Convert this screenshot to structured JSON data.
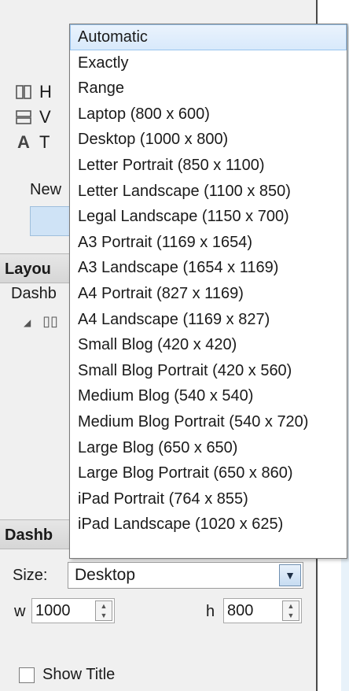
{
  "objects_panel": {
    "items": [
      {
        "icon": "horizontal-container-icon",
        "label": "H"
      },
      {
        "icon": "vertical-container-icon",
        "label": "V"
      },
      {
        "icon": "text-icon",
        "label": "T"
      }
    ],
    "new_label": "New"
  },
  "layout_section": {
    "title": "Layou",
    "dashboard_label": "Dashb"
  },
  "dashboard_section": {
    "title": "Dashb",
    "size_label": "Size:",
    "size_value": "Desktop",
    "width_label": "w",
    "width_value": "1000",
    "height_label": "h",
    "height_value": "800",
    "show_title_label": "Show Title"
  },
  "size_dropdown": {
    "selected": "Automatic",
    "options": [
      "Automatic",
      "Exactly",
      "Range",
      "Laptop (800 x 600)",
      "Desktop (1000 x 800)",
      "Letter Portrait (850 x 1100)",
      "Letter Landscape (1100 x 850)",
      "Legal Landscape (1150 x 700)",
      "A3 Portrait (1169 x 1654)",
      "A3 Landscape (1654 x 1169)",
      "A4 Portrait (827 x 1169)",
      "A4 Landscape (1169 x 827)",
      "Small Blog (420 x 420)",
      "Small Blog Portrait (420 x 560)",
      "Medium Blog (540 x 540)",
      "Medium Blog Portrait (540 x 720)",
      "Large Blog (650 x 650)",
      "Large Blog Portrait (650 x 860)",
      "iPad Portrait (764 x 855)",
      "iPad Landscape (1020 x 625)"
    ]
  }
}
